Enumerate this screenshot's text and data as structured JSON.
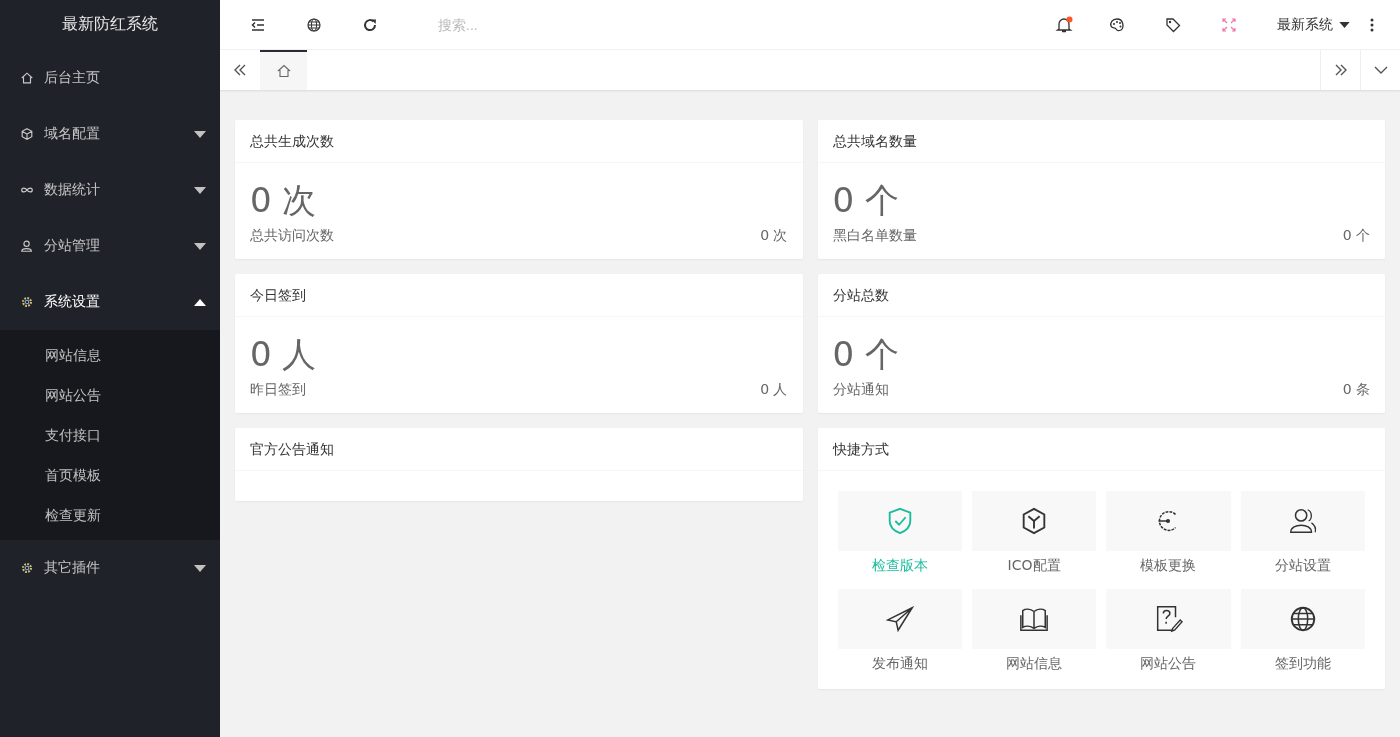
{
  "sidebar": {
    "logo": "最新防红系统",
    "items": [
      {
        "label": "后台主页"
      },
      {
        "label": "域名配置",
        "expanded": false
      },
      {
        "label": "数据统计",
        "expanded": false
      },
      {
        "label": "分站管理",
        "expanded": false
      },
      {
        "label": "系统设置",
        "expanded": true,
        "children": [
          {
            "label": "网站信息"
          },
          {
            "label": "网站公告"
          },
          {
            "label": "支付接口"
          },
          {
            "label": "首页模板"
          },
          {
            "label": "检查更新"
          }
        ]
      },
      {
        "label": "其它插件",
        "expanded": false
      }
    ]
  },
  "header": {
    "search": {
      "placeholder": "搜索..."
    },
    "notifications": {
      "unread": true
    },
    "user_menu": "最新系统"
  },
  "tabs": [
    {
      "kind": "home",
      "selected": true
    }
  ],
  "stat_cards": [
    {
      "title": "总共生成次数",
      "value": "0 次",
      "footer_label": "总共访问次数",
      "footer_value": "0 次"
    },
    {
      "title": "总共域名数量",
      "value": "0 个",
      "footer_label": "黑白名单数量",
      "footer_value": "0 个"
    },
    {
      "title": "今日签到",
      "value": "0 人",
      "footer_label": "昨日签到",
      "footer_value": "0 人"
    },
    {
      "title": "分站总数",
      "value": "0 个",
      "footer_label": "分站通知",
      "footer_value": "0 条"
    }
  ],
  "notice_card": {
    "title": "官方公告通知"
  },
  "shortcuts": {
    "title": "快捷方式",
    "items": [
      {
        "label": "检查版本",
        "selected": true
      },
      {
        "label": "ICO配置",
        "selected": false
      },
      {
        "label": "模板更换",
        "selected": false
      },
      {
        "label": "分站设置",
        "selected": false
      },
      {
        "label": "发布通知",
        "selected": false
      },
      {
        "label": "网站信息",
        "selected": false
      },
      {
        "label": "网站公告",
        "selected": false
      },
      {
        "label": "签到功能",
        "selected": false
      }
    ]
  }
}
